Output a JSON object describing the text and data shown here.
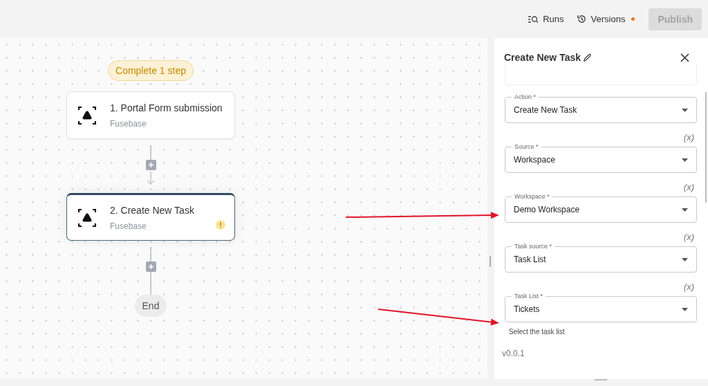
{
  "toolbar": {
    "runs": "Runs",
    "versions": "Versions",
    "versions_unsaved": true,
    "publish": "Publish",
    "publish_disabled": true
  },
  "canvas": {
    "status_badge": "Complete 1 step",
    "steps": [
      {
        "title": "1. Portal Form submission",
        "app": "Fusebase",
        "selected": false,
        "warning": false
      },
      {
        "title": "2. Create New Task",
        "app": "Fusebase",
        "selected": true,
        "warning": true
      }
    ],
    "end_label": "End"
  },
  "annotations": [
    {
      "kind": "arrow"
    },
    {
      "kind": "arrow"
    }
  ],
  "panel": {
    "title": "Create New Task",
    "fields": [
      {
        "label": "Action *",
        "value": "Create New Task"
      },
      {
        "variable_label": "(x)",
        "label": "Source *",
        "value": "Workspace"
      },
      {
        "variable_label": "(x)",
        "label": "Workspace *",
        "value": "Demo Workspace"
      },
      {
        "variable_label": "(x)",
        "label": "Task source *",
        "value": "Task List"
      },
      {
        "variable_label": "(x)",
        "label": "Task List *",
        "value": "Tickets"
      }
    ],
    "hint": "Select the task list",
    "version": "v0.0.1"
  }
}
